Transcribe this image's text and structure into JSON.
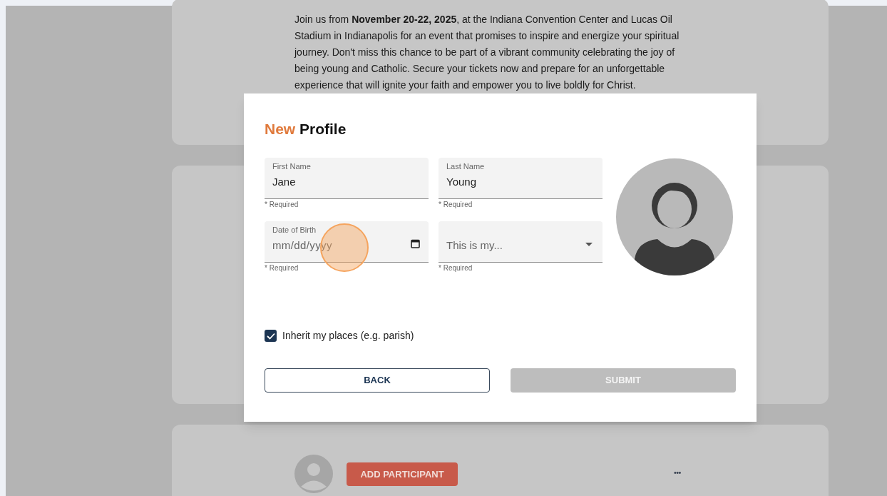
{
  "event_card": {
    "description": "Join us from **November 20-22, 2025**, at the Indiana Convention Center and Lucas Oil Stadium in Indianapolis for an event that promises to inspire and energize your spiritual journey. Don't miss this chance to be part of a vibrant community celebrating the joy of being young and Catholic. Secure your tickets now and prepare for an unforgettable experience that will ignite your faith and empower you to live boldly for Christ."
  },
  "participant_card": {
    "add_button": "ADD PARTICIPANT",
    "more_button": "•••"
  },
  "modal": {
    "title_accent": "New",
    "title": "Profile",
    "fields": [
      {
        "kind": "text",
        "label": "First Name",
        "value": "Jane",
        "helper": "* Required"
      },
      {
        "kind": "text",
        "label": "Last Name",
        "value": "Young",
        "helper": "* Required"
      },
      {
        "kind": "date",
        "label": "Date of Birth",
        "placeholder": "mm/dd/yyyy",
        "helper": "* Required"
      },
      {
        "kind": "select",
        "placeholder": "This is my...",
        "helper": "* Required"
      }
    ],
    "checkbox": {
      "label": "Inherit my places (e.g. parish)",
      "checked": true
    },
    "buttons": [
      {
        "kind": "outline",
        "label": "BACK",
        "disabled": false
      },
      {
        "kind": "filled",
        "label": "SUBMIT",
        "disabled": true
      }
    ]
  }
}
